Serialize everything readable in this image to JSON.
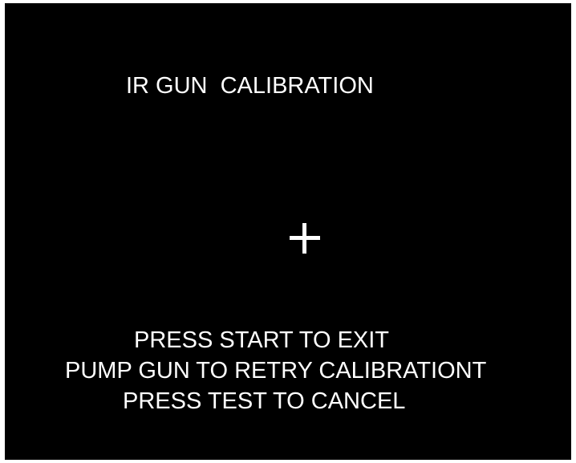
{
  "screen": {
    "title": "IR GUN  CALIBRATION",
    "target_icon": "crosshair-icon",
    "instructions": [
      "PRESS START TO EXIT",
      "PUMP GUN TO RETRY CALIBRATIONT",
      "PRESS TEST TO CANCEL"
    ],
    "colors": {
      "background": "#000000",
      "foreground": "#ffffff"
    }
  }
}
